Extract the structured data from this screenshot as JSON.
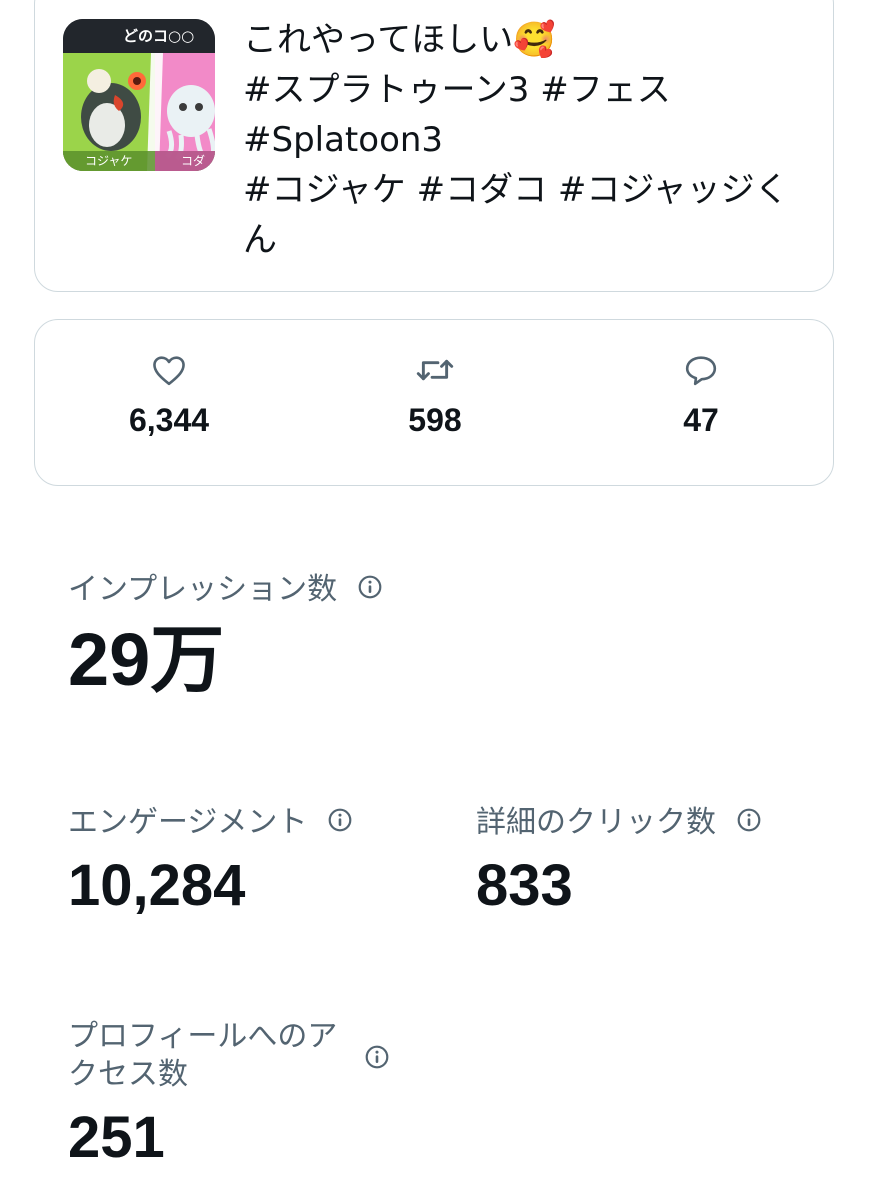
{
  "tweet": {
    "thumbnail": {
      "banner_text": "どのコ○○",
      "left_label": "コジャケ",
      "right_label": "コダ"
    },
    "lines": [
      "これやってほしい🥰",
      "#スプラトゥーン3 #フェス",
      "#Splatoon3",
      "#コジャケ #コダコ #コジャッジくん"
    ]
  },
  "stats": {
    "likes": "6,344",
    "retweets": "598",
    "replies": "47"
  },
  "metrics": {
    "impressions": {
      "label": "インプレッション数",
      "value": "29万"
    },
    "engagements": {
      "label": "エンゲージメント",
      "value": "10,284"
    },
    "detail_clicks": {
      "label": "詳細のクリック数",
      "value": "833"
    },
    "profile_visits": {
      "label": "プロフィールへのアクセス数",
      "value": "251"
    }
  },
  "colors": {
    "text": "#0f1419",
    "secondary": "#536471",
    "border": "#cfd9de",
    "thumb_green": "#9bd44a",
    "thumb_pink": "#f28ac8"
  },
  "icons": {
    "likes": "heart-icon",
    "retweets": "retweet-icon",
    "replies": "reply-icon",
    "info": "info-icon"
  }
}
